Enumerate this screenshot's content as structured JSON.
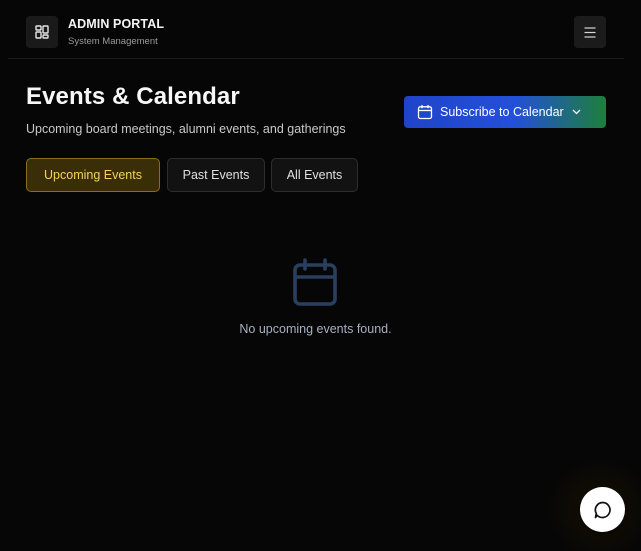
{
  "header": {
    "brand_title": "ADMIN PORTAL",
    "brand_subtitle": "System Management",
    "logo_icon": "dashboard-grid-icon",
    "menu_icon": "hamburger-menu-icon"
  },
  "main": {
    "title": "Events & Calendar",
    "subtitle": "Upcoming board meetings, alumni events, and gatherings",
    "subscribe_label": "Subscribe to Calendar",
    "subscribe_icon": "calendar-icon",
    "subscribe_chevron": "chevron-down-icon",
    "tabs": [
      {
        "label": "Upcoming Events",
        "active": true
      },
      {
        "label": "Past Events",
        "active": false
      },
      {
        "label": "All Events",
        "active": false
      }
    ],
    "empty_state": {
      "icon": "calendar-icon",
      "message": "No upcoming events found."
    }
  },
  "chat": {
    "icon": "chat-bubble-icon"
  },
  "colors": {
    "background": "#060606",
    "active_tab_text": "#f6d25a",
    "active_tab_border": "#8a6d14",
    "subscribe_gradient_start": "#1f44c8",
    "subscribe_gradient_end": "#1d7f3a",
    "empty_icon": "#2a3f5e"
  }
}
